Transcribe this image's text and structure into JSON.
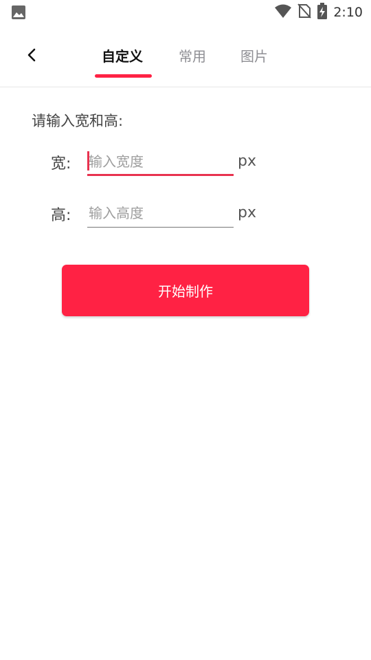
{
  "status_bar": {
    "time": "2:10",
    "icons": [
      "image-icon",
      "wifi-icon",
      "no-sim-icon",
      "battery-charging-icon"
    ]
  },
  "app_bar": {
    "tabs": [
      {
        "label": "自定义",
        "active": true
      },
      {
        "label": "常用",
        "active": false
      },
      {
        "label": "图片",
        "active": false
      }
    ],
    "accent_color": "#ff2244"
  },
  "form": {
    "prompt": "请输入宽和高:",
    "width": {
      "label": "宽:",
      "placeholder": "输入宽度",
      "value": "",
      "unit": "px"
    },
    "height": {
      "label": "高:",
      "placeholder": "输入高度",
      "value": "",
      "unit": "px"
    }
  },
  "start_button": {
    "label": "开始制作"
  }
}
